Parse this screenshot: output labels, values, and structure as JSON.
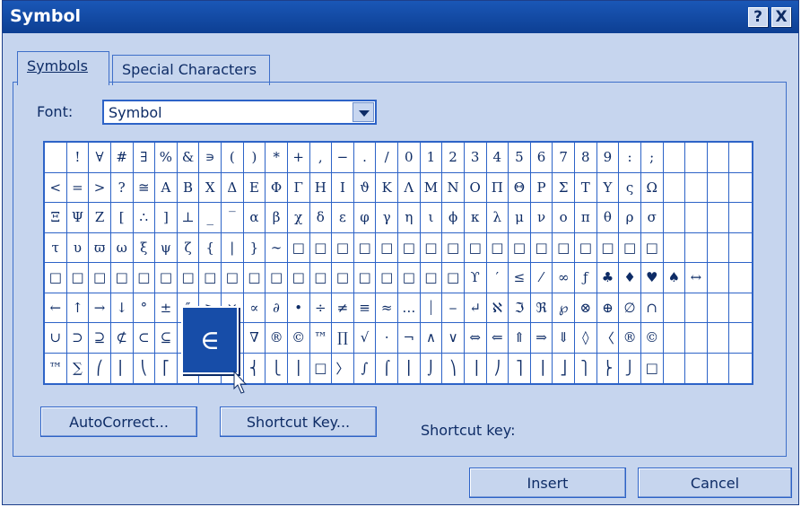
{
  "window": {
    "title": "Symbol",
    "help_button": "?",
    "close_button": "X"
  },
  "tabs": [
    {
      "label": "Symbols",
      "active": true
    },
    {
      "label": "Special Characters",
      "active": false
    }
  ],
  "font": {
    "label": "Font:",
    "value": "Symbol"
  },
  "symbol_rows": [
    [
      " ",
      "!",
      "∀",
      "#",
      "∃",
      "%",
      "&",
      "∍",
      "(",
      ")",
      "*",
      "+",
      ",",
      "−",
      ".",
      "/",
      "0",
      "1",
      "2",
      "3",
      "4",
      "5",
      "6",
      "7",
      "8",
      "9",
      ":",
      ";"
    ],
    [
      "<",
      "=",
      ">",
      "?",
      "≅",
      "Α",
      "Β",
      "Χ",
      "Δ",
      "Ε",
      "Φ",
      "Γ",
      "Η",
      "Ι",
      "ϑ",
      "Κ",
      "Λ",
      "Μ",
      "Ν",
      "Ο",
      "Π",
      "Θ",
      "Ρ",
      "Σ",
      "Τ",
      "Υ",
      "ς",
      "Ω"
    ],
    [
      "Ξ",
      "Ψ",
      "Ζ",
      "[",
      "∴",
      "]",
      "⊥",
      "_",
      "‾",
      "α",
      "β",
      "χ",
      "δ",
      "ε",
      "φ",
      "γ",
      "η",
      "ι",
      "ϕ",
      "κ",
      "λ",
      "μ",
      "ν",
      "ο",
      "π",
      "θ",
      "ρ",
      "σ"
    ],
    [
      "τ",
      "υ",
      "ϖ",
      "ω",
      "ξ",
      "ψ",
      "ζ",
      "{",
      "|",
      "}",
      "∼",
      "□",
      "□",
      "□",
      "□",
      "□",
      "□",
      "□",
      "□",
      "□",
      "□",
      "□",
      "□",
      "□",
      "□",
      "□",
      "□",
      "□"
    ],
    [
      "□",
      "□",
      "□",
      "□",
      "□",
      "□",
      "□",
      "□",
      "□",
      "□",
      "□",
      "□",
      "□",
      "□",
      "□",
      "□",
      "□",
      "□",
      "□",
      "ϒ",
      "′",
      "≤",
      "⁄",
      "∞",
      "ƒ",
      "♣",
      "♦",
      "♥",
      "♠",
      "↔"
    ],
    [
      "←",
      "↑",
      "→",
      "↓",
      "°",
      "±",
      "″",
      "≥",
      "×",
      "∝",
      "∂",
      "•",
      "÷",
      "≠",
      "≡",
      "≈",
      "…",
      "⏐",
      "⎯",
      "↵",
      "ℵ",
      "ℑ",
      "ℜ",
      "℘",
      "⊗",
      "⊕",
      "∅",
      "∩"
    ],
    [
      "∪",
      "⊃",
      "⊇",
      "⊄",
      "⊂",
      "⊆",
      "∈",
      "∉",
      "∠",
      "∇",
      "®",
      "©",
      "™",
      "∏",
      "√",
      "⋅",
      "¬",
      "∧",
      "∨",
      "⇔",
      "⇐",
      "⇑",
      "⇒",
      "⇓",
      "◊",
      "〈",
      "®",
      "©"
    ],
    [
      "™",
      "∑",
      "⎛",
      "⎜",
      "⎝",
      "⎡",
      "⎢",
      "⎣",
      "⎧",
      "⎨",
      "⎩",
      "⎪",
      "□",
      "〉",
      "∫",
      "⌠",
      "⎮",
      "⌡",
      "⎞",
      "⎟",
      "⎠",
      "⎤",
      "⎥",
      "⎦",
      "⎫",
      "⎬",
      "⎭",
      "□"
    ]
  ],
  "zoomed_symbol": "∈",
  "buttons": {
    "autocorrect": "AutoCorrect...",
    "shortcut_key": "Shortcut Key...",
    "insert": "Insert",
    "cancel": "Cancel"
  },
  "shortcut_key_label": "Shortcut key:"
}
